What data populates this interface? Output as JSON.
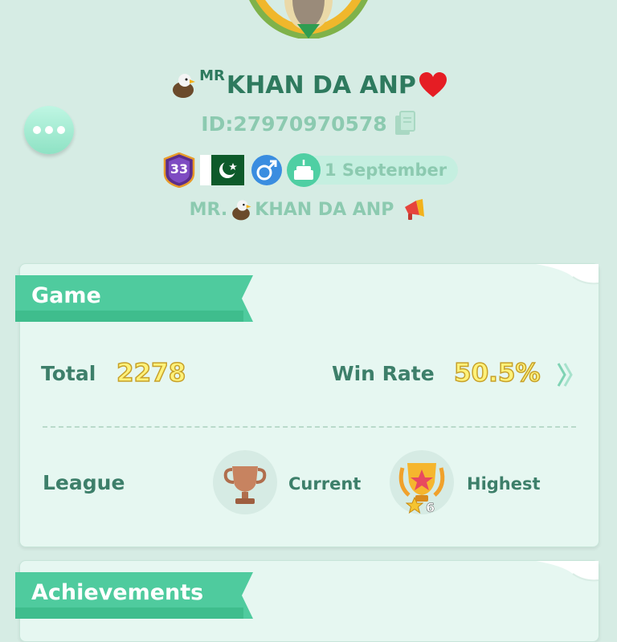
{
  "profile": {
    "name_prefix": "MR",
    "name": "KHAN DA ANP",
    "user_id": "ID:27970970578",
    "level": "33",
    "birthday": "1 September",
    "signature_prefix": "MR.",
    "signature_name": "KHAN DA ANP"
  },
  "game_card": {
    "title": "Game",
    "total_label": "Total",
    "total_value": "2278",
    "win_rate_label": "Win Rate",
    "win_rate_value": "50.5%",
    "league_label": "League",
    "current_label": "Current",
    "highest_label": "Highest",
    "highest_stars": "6"
  },
  "achievements_card": {
    "title": "Achievements"
  },
  "colors": {
    "background": "#d6ece4",
    "accent_green": "#3fbd8d",
    "text_green": "#2e7a5e",
    "value_yellow": "#fff27a"
  },
  "icons": [
    "more-icon",
    "eagle-icon",
    "heart-icon",
    "copy-icon",
    "level-badge-icon",
    "pakistan-flag-icon",
    "male-gender-icon",
    "birthday-cake-icon",
    "megaphone-icon",
    "chevron-right-icon",
    "bronze-trophy-icon",
    "gold-trophy-icon",
    "star-icon"
  ]
}
